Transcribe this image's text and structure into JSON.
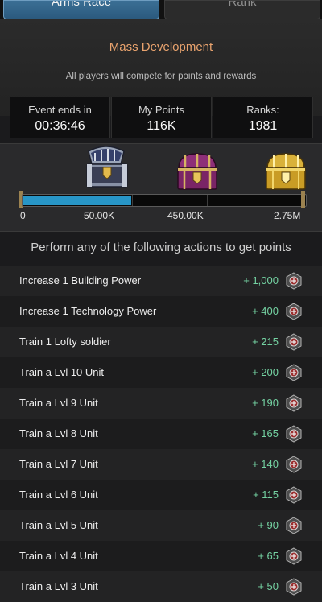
{
  "tabs": [
    {
      "label": "Arms Race",
      "active": true
    },
    {
      "label": "Rank",
      "active": false
    }
  ],
  "event": {
    "title": "Mass Development",
    "subtitle": "All players will compete for points and rewards"
  },
  "stats": [
    {
      "label": "Event ends in",
      "value": "00:36:46"
    },
    {
      "label": "My Points",
      "value": "116K"
    },
    {
      "label": "Ranks:",
      "value": "1981"
    }
  ],
  "progress": {
    "fill_fraction": 0.383,
    "milestones": [
      "0",
      "50.00K",
      "450.00K",
      "2.75M"
    ],
    "chests": [
      "silver-chest",
      "purple-chest",
      "gold-chest"
    ]
  },
  "actions": {
    "title": "Perform any of the following actions to get points",
    "items": [
      {
        "label": "Increase 1 Building Power",
        "points": "+ 1,000"
      },
      {
        "label": "Increase 1 Technology Power",
        "points": "+ 400"
      },
      {
        "label": "Train 1 Lofty soldier",
        "points": "+ 215"
      },
      {
        "label": "Train a Lvl 10 Unit",
        "points": "+ 200"
      },
      {
        "label": "Train a Lvl 9 Unit",
        "points": "+ 190"
      },
      {
        "label": "Train a Lvl 8 Unit",
        "points": "+ 165"
      },
      {
        "label": "Train a Lvl 7 Unit",
        "points": "+ 140"
      },
      {
        "label": "Train a Lvl 6 Unit",
        "points": "+ 115"
      },
      {
        "label": "Train a Lvl 5 Unit",
        "points": "+ 90"
      },
      {
        "label": "Train a Lvl 4 Unit",
        "points": "+ 65"
      },
      {
        "label": "Train a Lvl 3 Unit",
        "points": "+ 50"
      }
    ],
    "icon": "points-badge-icon"
  },
  "colors": {
    "accent_title": "#e9a36e",
    "points": "#74d2a2",
    "progress": "#2896c7"
  }
}
